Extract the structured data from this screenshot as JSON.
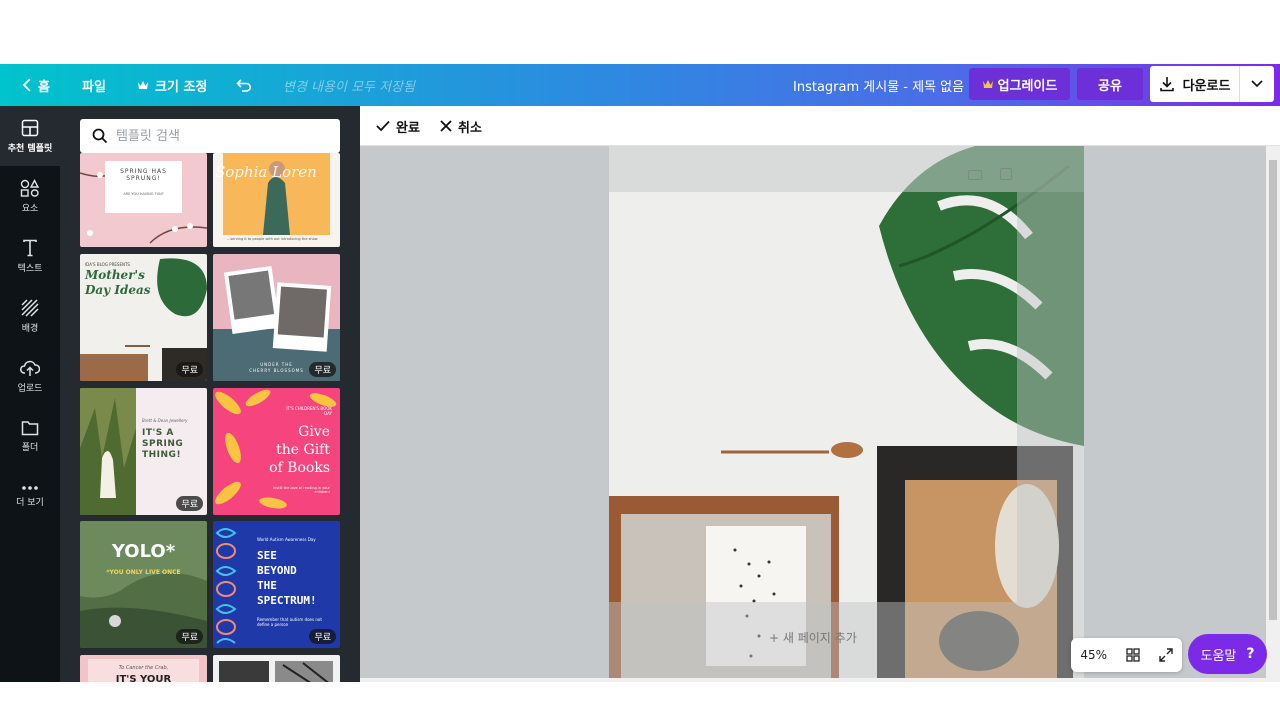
{
  "topbar": {
    "home_label": "홈",
    "file_label": "파일",
    "resize_label": "크기 조정",
    "saved_status": "변경 내용이 모두 저장됨",
    "document_title": "Instagram 게시물 - 제목 없음",
    "upgrade_label": "업그레이드",
    "share_label": "공유",
    "download_label": "다운로드"
  },
  "rail": {
    "items": [
      {
        "label": "추천 템플릿",
        "icon": "template-icon"
      },
      {
        "label": "요소",
        "icon": "elements-icon"
      },
      {
        "label": "텍스트",
        "icon": "text-icon"
      },
      {
        "label": "배경",
        "icon": "background-icon"
      },
      {
        "label": "업로드",
        "icon": "upload-icon"
      },
      {
        "label": "폴더",
        "icon": "folder-icon"
      },
      {
        "label": "더 보기",
        "icon": "more-icon"
      }
    ]
  },
  "panel": {
    "search_placeholder": "템플릿 검색",
    "templates": [
      {
        "name": "spring-has-sprung",
        "lines": [
          "SPRING HAS",
          "SPRUNG!"
        ],
        "sub": "ARE YOU HAVING FUN?"
      },
      {
        "name": "sophia-loren",
        "lines": [
          "Sophia Loren"
        ],
        "sub": "...serving it to people with out introducing the show"
      },
      {
        "name": "mothers-day-ideas",
        "lines": [
          "Mother's",
          "Day Ideas"
        ],
        "kicker": "IDA'S BLOG PRESENTS",
        "badge": "무료"
      },
      {
        "name": "photo-frames",
        "lines": [
          "UNDER THE",
          "CHERRY BLOSSOMS"
        ],
        "badge": "무료"
      },
      {
        "name": "spring-thing",
        "lines": [
          "IT'S A",
          "SPRING",
          "THING!"
        ],
        "kicker": "Brett & Dean Jewellery",
        "badge": "무료"
      },
      {
        "name": "gift-of-books",
        "lines": [
          "Give",
          "the Gift",
          "of Books"
        ],
        "kicker": "IT'S CHILDREN'S BOOK DAY",
        "sub": "Instill the love of reading in your children!"
      },
      {
        "name": "yolo",
        "lines": [
          "YOLO*"
        ],
        "sub": "*YOU ONLY LIVE ONCE",
        "badge": "무료"
      },
      {
        "name": "see-beyond",
        "lines": [
          "SEE",
          "BEYOND",
          "THE",
          "SPECTRUM!"
        ],
        "kicker": "World Autism Awareness Day",
        "sub": "Remember that autism does not define a person",
        "badge": "무료"
      },
      {
        "name": "cancer-crab",
        "lines": [
          "IT'S YOUR"
        ],
        "kicker": "To Cancer the Crab,"
      },
      {
        "name": "bw-photo",
        "lines": []
      }
    ]
  },
  "editor": {
    "done_label": "완료",
    "cancel_label": "취소",
    "add_page_label": "+ 새 페이지 추가",
    "zoom_level": "45%",
    "help_label": "도움말",
    "help_icon": "?"
  },
  "colors": {
    "accent_purple": "#7d2ae8",
    "brand_teal": "#00c4cc",
    "rail_bg": "#0e1318",
    "panel_bg": "#252a31"
  }
}
